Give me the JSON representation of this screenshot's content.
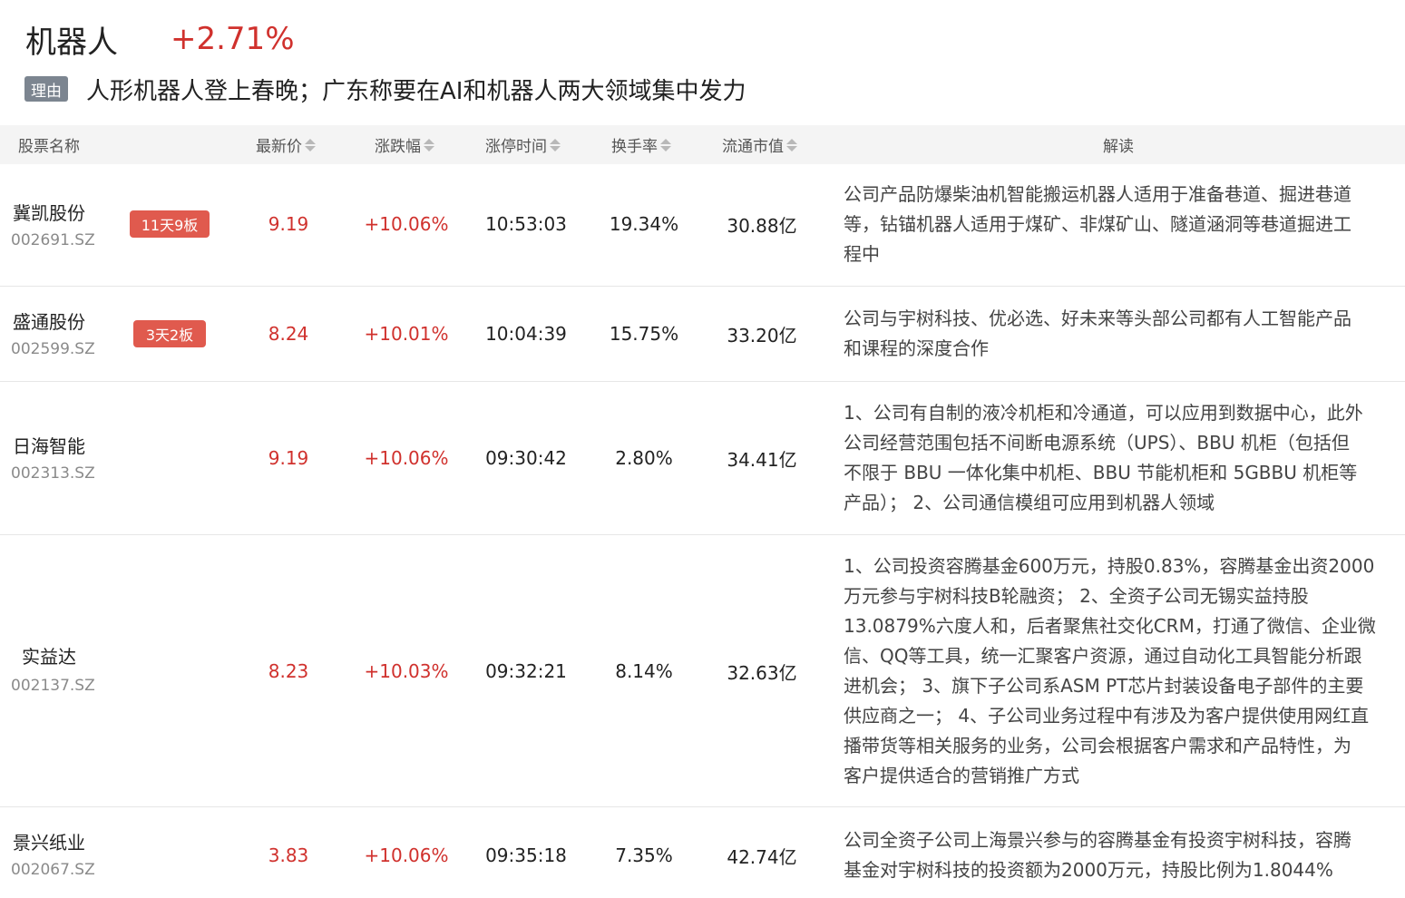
{
  "sector": {
    "name": "机器人",
    "change": "+2.71%"
  },
  "reason": {
    "tag": "理由",
    "text": "人形机器人登上春晚；广东称要在AI和机器人两大领域集中发力"
  },
  "columns": {
    "name": "股票名称",
    "price": "最新价",
    "change": "涨跌幅",
    "limit_time": "涨停时间",
    "turnover": "换手率",
    "market_cap": "流通市值",
    "analysis": "解读"
  },
  "colors": {
    "up": "#d0312d",
    "badge": "#e05a4e",
    "tag": "#7c8590",
    "header_bg": "#f4f4f4"
  },
  "rows": [
    {
      "name": "冀凯股份",
      "code": "002691.SZ",
      "badge": "11天9板",
      "price": "9.19",
      "change": "+10.06%",
      "limit_time": "10:53:03",
      "turnover": "19.34%",
      "market_cap": "30.88亿",
      "lines": [
        "公司产品防爆柴油机智能搬运机器人适用于准备巷道、掘进巷道",
        "等，钻锚机器人适用于煤矿、非煤矿山、隧道涵洞等巷道掘进工",
        "程中"
      ]
    },
    {
      "name": "盛通股份",
      "code": "002599.SZ",
      "badge": "3天2板",
      "price": "8.24",
      "change": "+10.01%",
      "limit_time": "10:04:39",
      "turnover": "15.75%",
      "market_cap": "33.20亿",
      "lines": [
        "公司与宇树科技、优必选、好未来等头部公司都有人工智能产品",
        "和课程的深度合作"
      ]
    },
    {
      "name": "日海智能",
      "code": "002313.SZ",
      "badge": "",
      "price": "9.19",
      "change": "+10.06%",
      "limit_time": "09:30:42",
      "turnover": "2.80%",
      "market_cap": "34.41亿",
      "lines": [
        "1、公司有自制的液冷机柜和冷通道，可以应用到数据中心，此外",
        "公司经营范围包括不间断电源系统（UPS）、BBU 机柜（包括但",
        "不限于 BBU 一体化集中机柜、BBU 节能机柜和 5GBBU 机柜等",
        "产品）； 2、公司通信模组可应用到机器人领域"
      ]
    },
    {
      "name": "实益达",
      "code": "002137.SZ",
      "badge": "",
      "price": "8.23",
      "change": "+10.03%",
      "limit_time": "09:32:21",
      "turnover": "8.14%",
      "market_cap": "32.63亿",
      "lines": [
        "1、公司投资容腾基金600万元，持股0.83%，容腾基金出资2000",
        "万元参与宇树科技B轮融资； 2、全资子公司无锡实益持股",
        "13.0879%六度人和，后者聚焦社交化CRM，打通了微信、企业微",
        "信、QQ等工具，统一汇聚客户资源，通过自动化工具智能分析跟",
        "进机会； 3、旗下子公司系ASM PT芯片封装设备电子部件的主要",
        "供应商之一； 4、子公司业务过程中有涉及为客户提供使用网红直",
        "播带货等相关服务的业务，公司会根据客户需求和产品特性，为",
        "客户提供适合的营销推广方式"
      ]
    },
    {
      "name": "景兴纸业",
      "code": "002067.SZ",
      "badge": "",
      "price": "3.83",
      "change": "+10.06%",
      "limit_time": "09:35:18",
      "turnover": "7.35%",
      "market_cap": "42.74亿",
      "lines": [
        "公司全资子公司上海景兴参与的容腾基金有投资宇树科技，容腾",
        "基金对宇树科技的投资额为2000万元，持股比例为1.8044%"
      ]
    }
  ]
}
